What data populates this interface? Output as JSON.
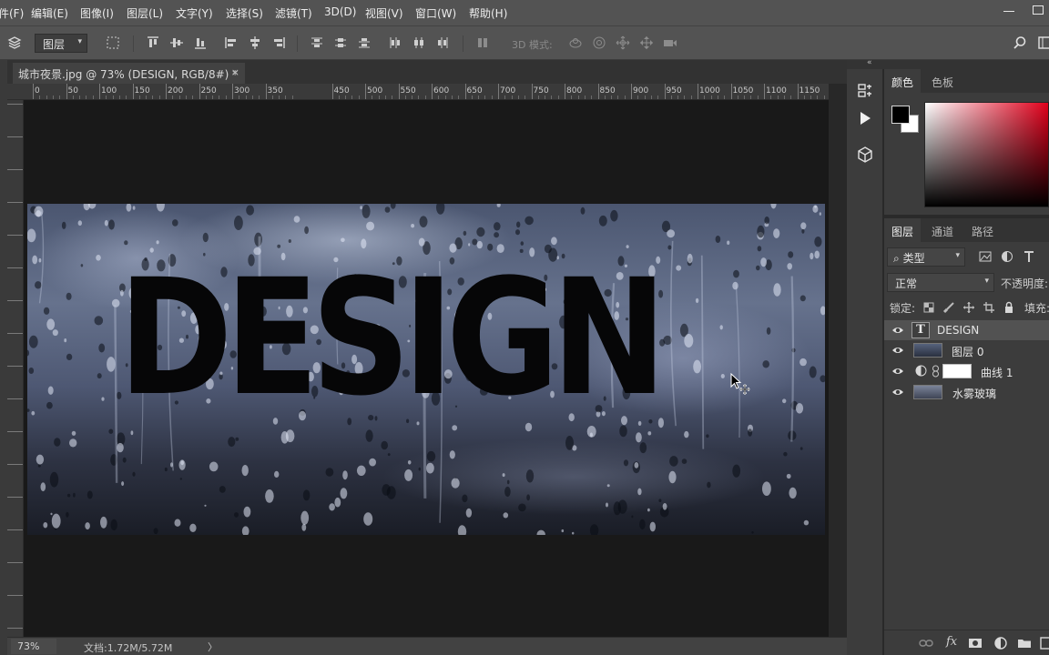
{
  "menu": {
    "file": "件(F)",
    "edit": "编辑(E)",
    "image": "图像(I)",
    "layer": "图层(L)",
    "type": "文字(Y)",
    "select": "选择(S)",
    "filter": "滤镜(T)",
    "three_d": "3D(D)",
    "view": "视图(V)",
    "window": "窗口(W)",
    "help": "帮助(H)"
  },
  "options": {
    "auto_select_target": "图层",
    "mode_3d_label": "3D 模式:"
  },
  "document": {
    "tab_title": "城市夜景.jpg @ 73% (DESIGN, RGB/8#) *",
    "close_glyph": "×",
    "canvas_text": "DESIGN"
  },
  "ruler": {
    "top_labels": [
      "0",
      "50",
      "100",
      "150",
      "200",
      "250",
      "300",
      "350",
      "450",
      "500",
      "550",
      "600",
      "650",
      "700",
      "750",
      "800",
      "850",
      "900",
      "950",
      "1000",
      "1050",
      "1100",
      "1150"
    ]
  },
  "status": {
    "zoom": "73%",
    "doc_size": "文档:1.72M/5.72M",
    "arrow": "〉"
  },
  "color_panel": {
    "tabs": [
      "颜色",
      "色板"
    ],
    "foreground": "#000000",
    "background": "#ffffff",
    "hue_color": "#e0001b"
  },
  "layers_panel": {
    "tabs": [
      "图层",
      "通道",
      "路径"
    ],
    "filter_kind": "类型",
    "blend_mode": "正常",
    "opacity_label": "不透明度:",
    "lock_label": "锁定:",
    "fill_label": "填充:",
    "layers": [
      {
        "name": "DESIGN",
        "kind": "text",
        "selected": true
      },
      {
        "name": "图层 0",
        "kind": "image",
        "selected": false
      },
      {
        "name": "曲线 1",
        "kind": "adjustment",
        "selected": false
      },
      {
        "name": "水雾玻璃",
        "kind": "image",
        "selected": false
      }
    ],
    "footer_fx": "fx"
  },
  "icons": {
    "options": [
      "move-tool-icon",
      "align-top-icon",
      "align-vcenter-icon",
      "align-bottom-icon",
      "align-left-icon",
      "align-hcenter-icon",
      "align-right-icon",
      "distribute-icon"
    ],
    "mode_3d": [
      "orbit-3d-icon",
      "roll-3d-icon",
      "pan-3d-icon",
      "slide-3d-icon",
      "camera-3d-icon"
    ],
    "dock": [
      "history-icon",
      "actions-play-icon",
      "3d-cube-icon"
    ]
  }
}
